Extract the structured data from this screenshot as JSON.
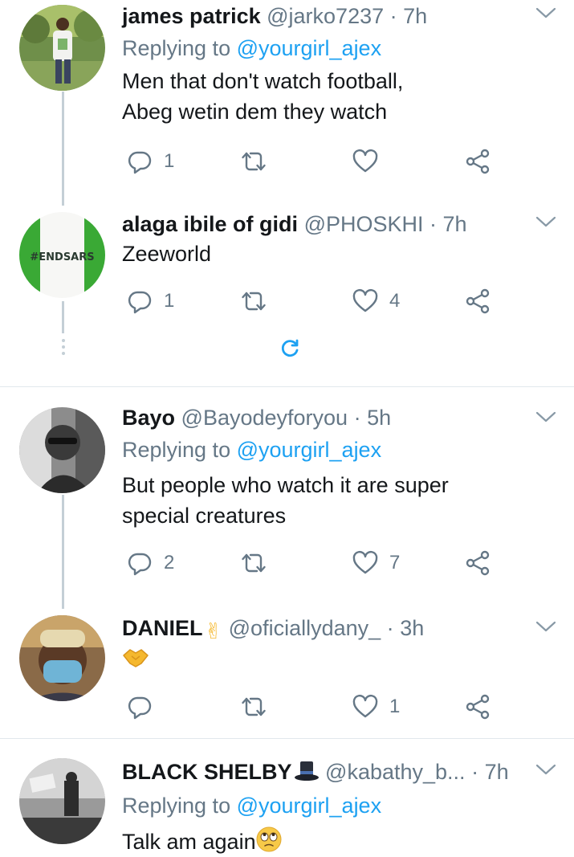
{
  "tweets": [
    {
      "name": "james patrick",
      "handle": "@jarko7237",
      "time": "7h",
      "replying_prefix": "Replying to ",
      "replying_to": "@yourgirl_ajex",
      "lines": [
        "Men that don't watch football,",
        "Abeg wetin dem they watch"
      ],
      "reply_count": "1",
      "retweet_count": "",
      "like_count": ""
    },
    {
      "name": "alaga ibile of gidi",
      "handle": "@PHOSKHI",
      "time": "7h",
      "avatar_text": "#ENDSARS",
      "lines": [
        "Zeeworld"
      ],
      "reply_count": "1",
      "retweet_count": "",
      "like_count": "4"
    },
    {
      "name": "Bayo",
      "handle": "@Bayodeyforyou",
      "time": "5h",
      "replying_prefix": "Replying to ",
      "replying_to": "@yourgirl_ajex",
      "lines": [
        "But people who watch it are super",
        "special creatures"
      ],
      "reply_count": "2",
      "retweet_count": "",
      "like_count": "7"
    },
    {
      "name": "DANIEL",
      "name_emoji": "✌",
      "handle": "@oficiallydany_",
      "time": "3h",
      "body_emoji": "handshake",
      "reply_count": "",
      "retweet_count": "",
      "like_count": "1"
    },
    {
      "name": "BLACK SHELBY",
      "name_emoji": "top-hat",
      "handle": "@kabathy_b...",
      "time": "7h",
      "replying_prefix": "Replying to ",
      "replying_to": "@yourgirl_ajex",
      "lines": [
        "Talk am again"
      ],
      "body_emoji": "face-with-rolling-eyes"
    }
  ],
  "separator": "·",
  "icons": [
    "reply-icon",
    "retweet-icon",
    "like-icon",
    "share-icon",
    "chevron-down-icon",
    "refresh-icon"
  ],
  "colors": {
    "link": "#1da1f2",
    "muted": "#657786",
    "text": "#14171a",
    "thread": "#c4cfd6"
  }
}
